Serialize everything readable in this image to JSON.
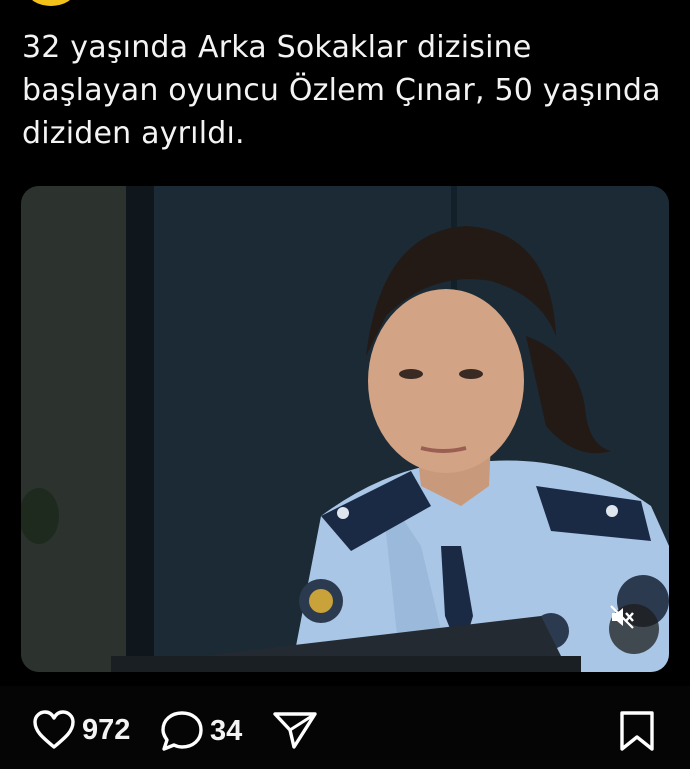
{
  "post": {
    "text": "32 yaşında Arka Sokaklar dizisine başlayan oyuncu Özlem Çınar, 50 yaşında diziden ayrıldı."
  },
  "actions": {
    "likes": "972",
    "comments": "34"
  },
  "icons": {
    "like": "heart-icon",
    "comment": "comment-bubble-icon",
    "share": "send-icon",
    "save": "bookmark-icon",
    "mute": "speaker-muted-icon"
  },
  "colors": {
    "background": "#000000",
    "text": "#f4f4f4",
    "avatar": "#f2c21b"
  }
}
